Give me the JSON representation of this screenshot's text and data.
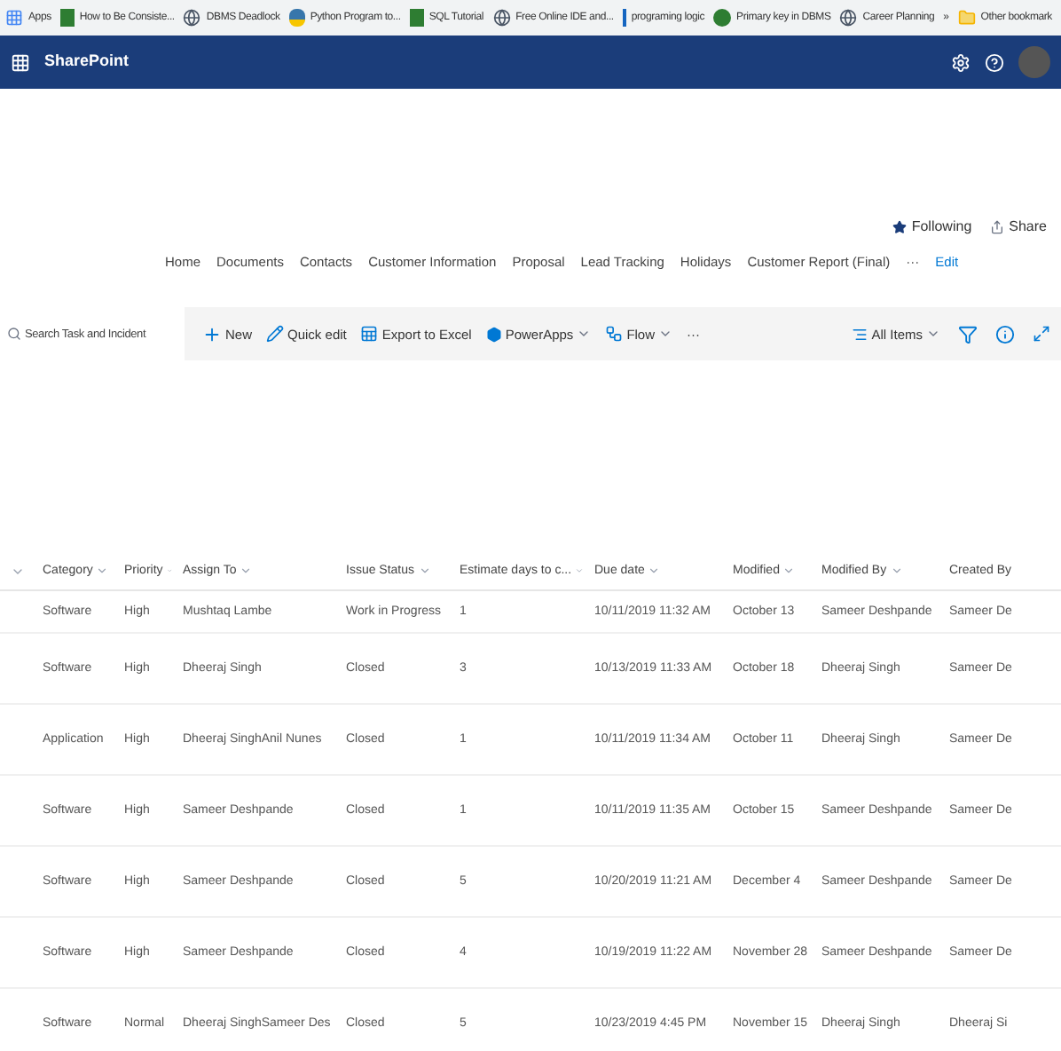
{
  "bookmarks": [
    {
      "label": "Apps",
      "kind": "apps"
    },
    {
      "label": "How to Be Consiste...",
      "kind": "green"
    },
    {
      "label": "DBMS Deadlock",
      "kind": "globe"
    },
    {
      "label": "Python Program to...",
      "kind": "python"
    },
    {
      "label": "SQL Tutorial",
      "kind": "green"
    },
    {
      "label": "Free Online IDE and...",
      "kind": "globe"
    },
    {
      "label": "programing logic",
      "kind": "bar"
    },
    {
      "label": "Primary key in DBMS",
      "kind": "circle"
    },
    {
      "label": "Career Planning",
      "kind": "globe"
    },
    {
      "label": "»",
      "kind": "more"
    },
    {
      "label": "Other bookmark",
      "kind": "folder"
    }
  ],
  "suite_bar": {
    "title": "SharePoint"
  },
  "site_actions": [
    "Following",
    "Share"
  ],
  "nav": [
    {
      "label": "Home",
      "kind": "link"
    },
    {
      "label": "Documents",
      "kind": "link"
    },
    {
      "label": "Contacts",
      "kind": "link"
    },
    {
      "label": "Customer Information",
      "kind": "link"
    },
    {
      "label": "Proposal",
      "kind": "link"
    },
    {
      "label": "Lead Tracking",
      "kind": "link"
    },
    {
      "label": "Holidays",
      "kind": "link"
    },
    {
      "label": "Customer Report (Final)",
      "kind": "link"
    },
    {
      "label": "···",
      "kind": "more"
    },
    {
      "label": "Edit",
      "kind": "edit"
    }
  ],
  "search": {
    "placeholder": "Search Task and Incident"
  },
  "commands": [
    {
      "label": "New",
      "kind": "new"
    },
    {
      "label": "Quick edit",
      "kind": "edit"
    },
    {
      "label": "Export to Excel",
      "kind": "excel"
    },
    {
      "label": "PowerApps",
      "kind": "powerapps"
    },
    {
      "label": "Flow",
      "kind": "flow"
    },
    {
      "label": "···",
      "kind": "more"
    }
  ],
  "view": {
    "label": "All Items"
  },
  "table": {
    "columns": [
      "Category",
      "Priority",
      "Assign To",
      "Issue Status",
      "Estimate days to c...",
      "Due date",
      "Modified",
      "Modified By",
      "Created By"
    ],
    "rows": [
      [
        "Software",
        "High",
        "Mushtaq Lambe",
        "Work in Progress",
        "1",
        "10/11/2019 11:32 AM",
        "October 13",
        "Sameer Deshpande",
        "Sameer De"
      ],
      [
        "Software",
        "High",
        "Dheeraj Singh",
        "Closed",
        "3",
        "10/13/2019 11:33 AM",
        "October 18",
        "Dheeraj Singh",
        "Sameer De"
      ],
      [
        "Application",
        "High",
        "Dheeraj SinghAnil Nunes",
        "Closed",
        "1",
        "10/11/2019 11:34 AM",
        "October 11",
        "Dheeraj Singh",
        "Sameer De"
      ],
      [
        "Software",
        "High",
        "Sameer Deshpande",
        "Closed",
        "1",
        "10/11/2019 11:35 AM",
        "October 15",
        "Sameer Deshpande",
        "Sameer De"
      ],
      [
        "Software",
        "High",
        "Sameer Deshpande",
        "Closed",
        "5",
        "10/20/2019 11:21 AM",
        "December 4",
        "Sameer Deshpande",
        "Sameer De"
      ],
      [
        "Software",
        "High",
        "Sameer Deshpande",
        "Closed",
        "4",
        "10/19/2019 11:22 AM",
        "November 28",
        "Sameer Deshpande",
        "Sameer De"
      ],
      [
        "Software",
        "Normal",
        "Dheeraj SinghSameer Des",
        "Closed",
        "5",
        "10/23/2019 4:45 PM",
        "November 15",
        "Dheeraj Singh",
        "Dheeraj Si"
      ]
    ]
  }
}
